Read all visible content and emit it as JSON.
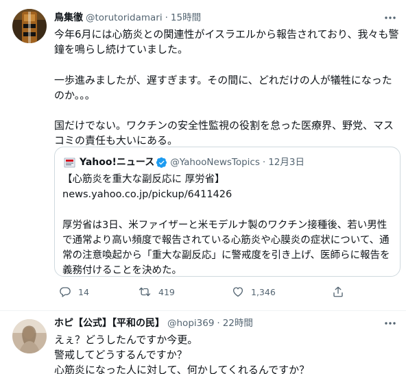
{
  "tweet1": {
    "author_name": "鳥集徹",
    "author_handle": "@torutoridamari",
    "separator": "·",
    "time": "15時間",
    "text": "今年6月には心筋炎との関連性がイスラエルから報告されており、我々も警鐘を鳴らし続けていました。\n\n一歩進みましたが、遅すぎます。その間に、どれだけの人が犠牲になったのか。。。\n\n国だけでない。ワクチンの安全性監視の役割を怠った医療界、野党、マスコミの責任も大いにある。",
    "quote": {
      "account_name": "Yahoo!ニュース",
      "account_handle": "@YahooNewsTopics",
      "separator": "·",
      "date": "12月3日",
      "text": "【心筋炎を重大な副反応に 厚労省】\nnews.yahoo.co.jp/pickup/6411426\n\n厚労省は3日、米ファイザーと米モデルナ製のワクチン接種後、若い男性で通常より高い頻度で報告されている心筋炎や心膜炎の症状について、通常の注意喚起から「重大な副反応」に警戒度を引き上げ、医師らに報告を義務付けることを決めた。"
    },
    "actions": {
      "replies": "14",
      "retweets": "419",
      "likes": "1,346"
    }
  },
  "tweet2": {
    "author_name": "ホピ【公式】【平和の民】",
    "author_handle": "@hopi369",
    "separator": "·",
    "time": "22時間",
    "text": "えぇ？どうしたんですか今更。\n警戒してどうするんですか？\n心筋炎になった人に対して、何かしてくれるんですか？"
  },
  "icons": {
    "more": "more-dots-icon",
    "reply": "reply-icon",
    "retweet": "retweet-icon",
    "like": "heart-icon",
    "share": "share-icon",
    "verified": "verified-badge-icon"
  },
  "colors": {
    "text": "#0f1419",
    "secondary": "#536471",
    "border": "#cfd9de",
    "verified": "#1d9bf0"
  }
}
